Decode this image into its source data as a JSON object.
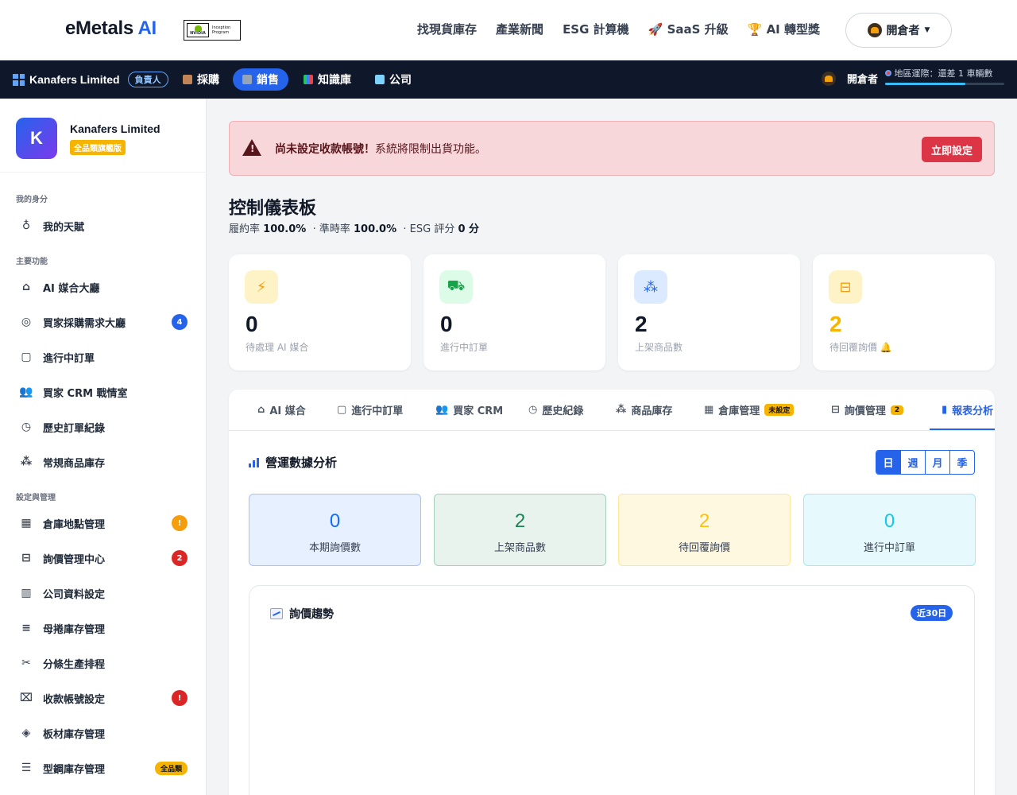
{
  "header": {
    "brand_main": "eMetals",
    "brand_ai": "AI",
    "badge_line1": "Inception",
    "badge_line2": "Program",
    "badge_logo": "NVIDIA",
    "nav": [
      "找現貨庫存",
      "產業新聞",
      "ESG 計算機"
    ],
    "saas_label": "SaaS 升級",
    "award_label": "AI 轉型獎",
    "user_label": "開倉者"
  },
  "subnav": {
    "company": "Kanafers Limited",
    "role": "負責人",
    "items": [
      "採購",
      "銷售",
      "知識庫",
      "公司"
    ],
    "active_index": 1,
    "user": "開倉者",
    "region_text": "地區運際：還差 1 車輛數",
    "region_progress": 0.67
  },
  "sidebar": {
    "avatar_letter": "K",
    "company": "Kanafers Limited",
    "plan_badge": "全品類旗艦版",
    "sections": [
      "我的身分",
      "主要功能",
      "設定與管理"
    ],
    "identity_items": [
      {
        "label": "我的天賦",
        "icon": "award-icon"
      }
    ],
    "main_items": [
      {
        "label": "AI 媒合大廳",
        "icon": "robot-icon",
        "count": ""
      },
      {
        "label": "買家採購需求大廳",
        "icon": "target-icon",
        "count": "4"
      },
      {
        "label": "進行中訂單",
        "icon": "box-icon",
        "count": ""
      },
      {
        "label": "買家 CRM 戰情室",
        "icon": "people-icon",
        "count": ""
      },
      {
        "label": "歷史訂單紀錄",
        "icon": "clock-icon",
        "count": ""
      },
      {
        "label": "常規商品庫存",
        "icon": "boxes-icon",
        "count": ""
      }
    ],
    "settings_items": [
      {
        "label": "倉庫地點管理",
        "icon": "building-icon",
        "count": "!"
      },
      {
        "label": "詢價管理中心",
        "icon": "inbox-icon",
        "count": "2"
      },
      {
        "label": "公司資料設定",
        "icon": "office-icon",
        "count": ""
      },
      {
        "label": "母捲庫存管理",
        "icon": "database-icon",
        "count": ""
      },
      {
        "label": "分條生產排程",
        "icon": "scissors-icon",
        "count": ""
      },
      {
        "label": "收款帳號設定",
        "icon": "bank-icon",
        "count": "!"
      },
      {
        "label": "板材庫存管理",
        "icon": "layers-icon",
        "count": ""
      },
      {
        "label": "型鋼庫存管理",
        "icon": "list-icon",
        "count": "全品類"
      }
    ]
  },
  "alert": {
    "bold": "尚未設定收款帳號！",
    "text": "系統將限制出貨功能。",
    "button": "立即設定"
  },
  "page": {
    "title": "控制儀表板",
    "fulfill_label": "履約率",
    "fulfill_value": "100.0%",
    "ontime_label": "· 準時率",
    "ontime_value": "100.0%",
    "esg_label": "· ESG 評分",
    "esg_value": "0 分"
  },
  "stats": [
    {
      "value": "0",
      "label": "待處理 AI 媒合",
      "icon": "lightning-icon",
      "bg": "#fef3c7",
      "color": "#f59e0b"
    },
    {
      "value": "0",
      "label": "進行中訂單",
      "icon": "truck-icon",
      "bg": "#dcfce7",
      "color": "#16a34a"
    },
    {
      "value": "2",
      "label": "上架商品數",
      "icon": "boxes-icon",
      "bg": "#dbeafe",
      "color": "#2563eb"
    },
    {
      "value": "2",
      "label": "待回覆詢價 🔔",
      "icon": "inbox-icon",
      "bg": "#fef3c7",
      "color": "#f59e0b"
    }
  ],
  "tabs": [
    {
      "label": "AI 媒合",
      "icon": "robot-icon",
      "badge": ""
    },
    {
      "label": "進行中訂單",
      "icon": "box-icon",
      "badge": ""
    },
    {
      "label": "買家 CRM",
      "icon": "people-icon",
      "badge": ""
    },
    {
      "label": "歷史紀錄",
      "icon": "clock-icon",
      "badge": ""
    },
    {
      "label": "商品庫存",
      "icon": "boxes-icon",
      "badge": ""
    },
    {
      "label": "倉庫管理",
      "icon": "building-icon",
      "badge": "未設定"
    },
    {
      "label": "詢價管理",
      "icon": "inbox-icon",
      "badge": "2"
    },
    {
      "label": "報表分析",
      "icon": "bar-chart-icon",
      "badge": ""
    }
  ],
  "analytics": {
    "title": "營運數據分析",
    "periods": [
      "日",
      "週",
      "月",
      "季"
    ],
    "kpis": [
      {
        "value": "0",
        "label": "本期詢價數",
        "bg": "#e7f0ff",
        "border": "#9ec5fe",
        "color": "#0d6efd"
      },
      {
        "value": "2",
        "label": "上架商品數",
        "bg": "#e8f3ee",
        "border": "#a3cfbb",
        "color": "#198754"
      },
      {
        "value": "2",
        "label": "待回覆詢價",
        "bg": "#fff8e1",
        "border": "#ffe69c",
        "color": "#ffc107"
      },
      {
        "value": "0",
        "label": "進行中訂單",
        "bg": "#e6f9fc",
        "border": "#9eeaf9",
        "color": "#0dcaf0"
      }
    ],
    "trend_title": "詢價趨勢",
    "trend_range": "近30日"
  }
}
